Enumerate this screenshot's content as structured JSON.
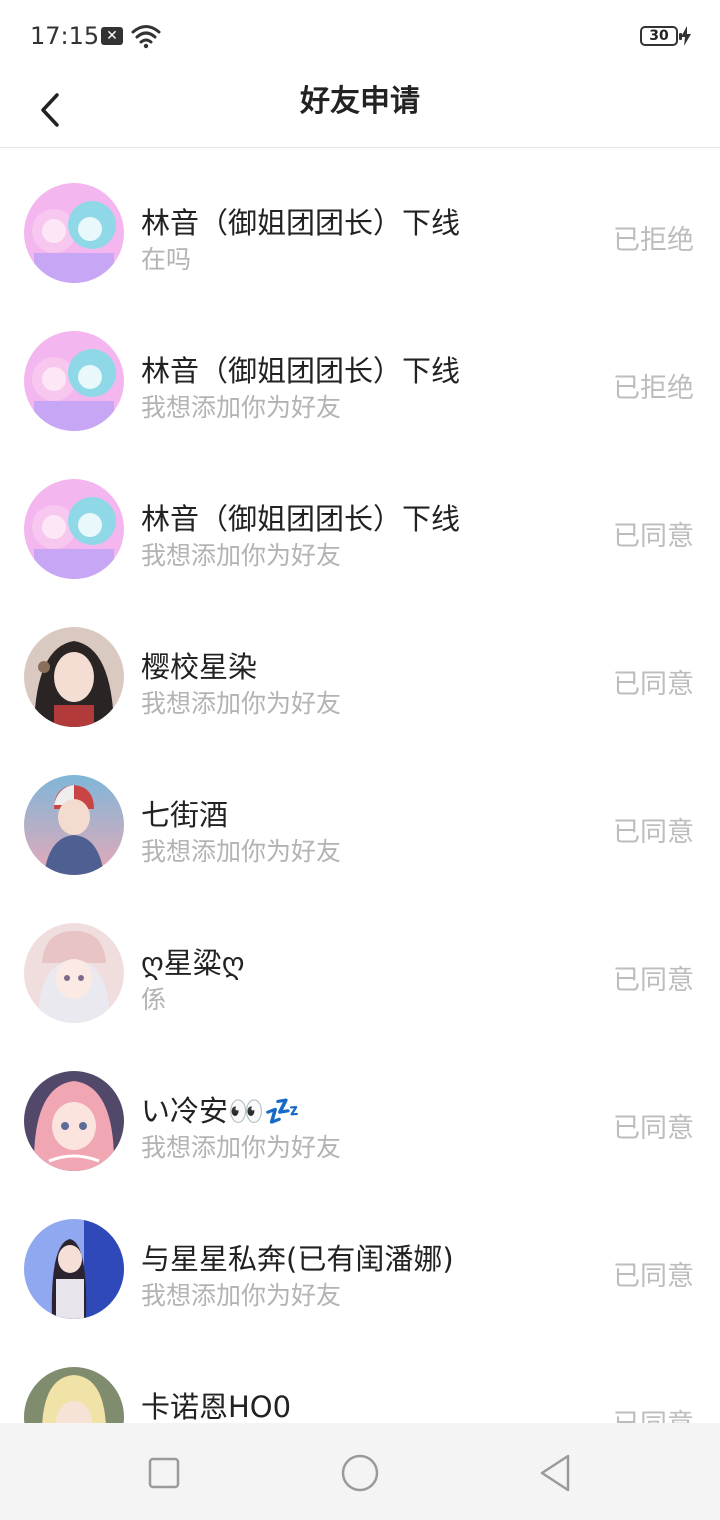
{
  "status_bar": {
    "time": "17:15",
    "battery": "30"
  },
  "header": {
    "title": "好友申请"
  },
  "requests": [
    {
      "name": "林音（御姐团团长）下线",
      "message": "在吗",
      "status": "已拒绝",
      "avatar": "avatar-pink-twins"
    },
    {
      "name": "林音（御姐团团长）下线",
      "message": "我想添加你为好友",
      "status": "已拒绝",
      "avatar": "avatar-pink-twins"
    },
    {
      "name": "林音（御姐团团长）下线",
      "message": "我想添加你为好友",
      "status": "已同意",
      "avatar": "avatar-pink-twins"
    },
    {
      "name": "樱校星染",
      "message": "我想添加你为好友",
      "status": "已同意",
      "avatar": "avatar-dark-hair-girl"
    },
    {
      "name": "七街酒",
      "message": "我想添加你为好友",
      "status": "已同意",
      "avatar": "avatar-boy-sunset"
    },
    {
      "name": "ღ星粱ღ",
      "message": "係",
      "status": "已同意",
      "avatar": "avatar-white-hair-cap"
    },
    {
      "name": "い冷安👀💤",
      "message": "我想添加你为好友",
      "status": "已同意",
      "avatar": "avatar-pink-hair-girl"
    },
    {
      "name": "与星星私奔(已有闺潘娜)",
      "message": "我想添加你为好友",
      "status": "已同意",
      "avatar": "avatar-girl-blue-poster"
    },
    {
      "name": "卡诺恩HO0",
      "message": "",
      "status": "已同意",
      "avatar": "avatar-blonde-boy"
    }
  ],
  "colors": {
    "title_text": "#222222",
    "secondary_text": "#b3b3b3",
    "status_text": "#bdbdbd",
    "nav_bg": "#f4f4f4"
  }
}
